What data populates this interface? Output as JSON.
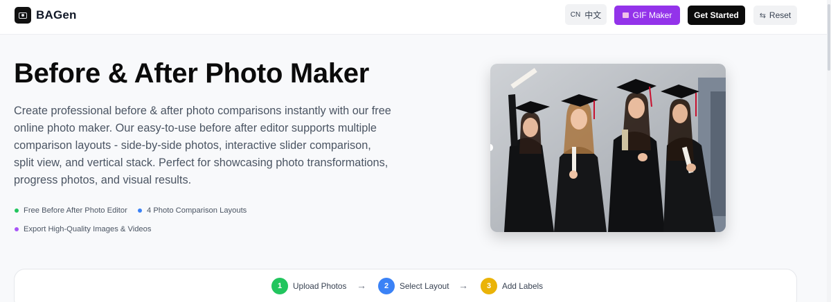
{
  "header": {
    "brand": "BAGen",
    "lang_code": "CN",
    "lang_label": "中文",
    "gif_label": "GIF Maker",
    "start_label": "Get Started",
    "reset_label": "Reset",
    "reset_icon": "⇆"
  },
  "hero": {
    "title": "Before & After Photo Maker",
    "description": "Create professional before & after photo comparisons instantly with our free online photo maker. Our easy-to-use before after editor supports multiple comparison layouts - side-by-side photos, interactive slider comparison, split view, and vertical stack. Perfect for showcasing photo transformations, progress photos, and visual results.",
    "features": [
      {
        "label": "Free Before After Photo Editor",
        "color": "#22c55e"
      },
      {
        "label": "4 Photo Comparison Layouts",
        "color": "#3b82f6"
      },
      {
        "label": "Export High-Quality Images & Videos",
        "color": "#a855f7"
      }
    ]
  },
  "steps": [
    {
      "num": "1",
      "label": "Upload Photos",
      "color": "#22c55e"
    },
    {
      "num": "2",
      "label": "Select Layout",
      "color": "#3b82f6"
    },
    {
      "num": "3",
      "label": "Add Labels",
      "color": "#eab308"
    }
  ],
  "step_arrow": "→",
  "colors": {
    "accent_purple": "#9333ea",
    "primary_black": "#0b0b0b"
  }
}
